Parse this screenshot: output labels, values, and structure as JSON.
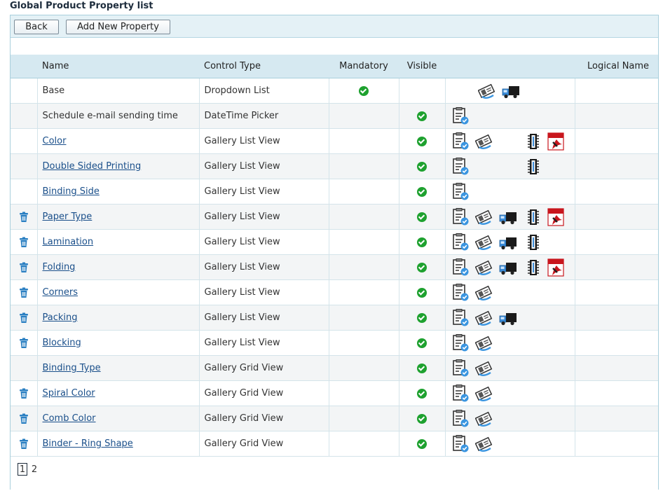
{
  "page": {
    "title": "Global Product Property list"
  },
  "toolbar": {
    "back_label": "Back",
    "add_label": "Add New Property"
  },
  "table": {
    "headers": {
      "name": "Name",
      "control_type": "Control Type",
      "mandatory": "Mandatory",
      "visible": "Visible",
      "actions": "",
      "logical_name": "Logical Name"
    },
    "rows": [
      {
        "name": "Base",
        "link": false,
        "deletable": false,
        "control": "Dropdown List",
        "mandatory": true,
        "visible": false,
        "icons": [
          "price-icon",
          "delivery-truck-icon"
        ]
      },
      {
        "name": "Schedule e-mail sending time",
        "link": false,
        "deletable": false,
        "control": "DateTime Picker",
        "mandatory": false,
        "visible": true,
        "icons": [
          "clipboard-check-icon"
        ]
      },
      {
        "name": "Color",
        "link": true,
        "deletable": false,
        "control": "Gallery List View",
        "mandatory": false,
        "visible": true,
        "icons": [
          "clipboard-check-icon",
          "price-icon",
          "chip-icon",
          "pdf-icon"
        ]
      },
      {
        "name": "Double Sided Printing",
        "link": true,
        "deletable": false,
        "control": "Gallery List View",
        "mandatory": false,
        "visible": true,
        "icons": [
          "clipboard-check-icon",
          "chip-icon"
        ]
      },
      {
        "name": "Binding Side",
        "link": true,
        "deletable": false,
        "control": "Gallery List View",
        "mandatory": false,
        "visible": true,
        "icons": [
          "clipboard-check-icon"
        ]
      },
      {
        "name": "Paper Type",
        "link": true,
        "deletable": true,
        "control": "Gallery List View",
        "mandatory": false,
        "visible": true,
        "icons": [
          "clipboard-check-icon",
          "price-icon",
          "delivery-truck-icon",
          "chip-icon",
          "pdf-icon"
        ]
      },
      {
        "name": "Lamination",
        "link": true,
        "deletable": true,
        "control": "Gallery List View",
        "mandatory": false,
        "visible": true,
        "icons": [
          "clipboard-check-icon",
          "price-icon",
          "delivery-truck-icon",
          "chip-icon"
        ]
      },
      {
        "name": "Folding",
        "link": true,
        "deletable": true,
        "control": "Gallery List View",
        "mandatory": false,
        "visible": true,
        "icons": [
          "clipboard-check-icon",
          "price-icon",
          "delivery-truck-icon",
          "chip-icon",
          "pdf-icon"
        ]
      },
      {
        "name": "Corners",
        "link": true,
        "deletable": true,
        "control": "Gallery List View",
        "mandatory": false,
        "visible": true,
        "icons": [
          "clipboard-check-icon",
          "price-icon"
        ]
      },
      {
        "name": "Packing",
        "link": true,
        "deletable": true,
        "control": "Gallery List View",
        "mandatory": false,
        "visible": true,
        "icons": [
          "clipboard-check-icon",
          "price-icon",
          "delivery-truck-icon"
        ]
      },
      {
        "name": "Blocking",
        "link": true,
        "deletable": true,
        "control": "Gallery List View",
        "mandatory": false,
        "visible": true,
        "icons": [
          "clipboard-check-icon",
          "price-icon"
        ]
      },
      {
        "name": "Binding Type",
        "link": true,
        "deletable": false,
        "control": "Gallery Grid View",
        "mandatory": false,
        "visible": true,
        "icons": [
          "clipboard-check-icon",
          "price-icon"
        ]
      },
      {
        "name": "Spiral Color",
        "link": true,
        "deletable": true,
        "control": "Gallery Grid View",
        "mandatory": false,
        "visible": true,
        "icons": [
          "clipboard-check-icon",
          "price-icon"
        ]
      },
      {
        "name": "Comb Color",
        "link": true,
        "deletable": true,
        "control": "Gallery Grid View",
        "mandatory": false,
        "visible": true,
        "icons": [
          "clipboard-check-icon",
          "price-icon"
        ]
      },
      {
        "name": "Binder - Ring Shape",
        "link": true,
        "deletable": true,
        "control": "Gallery Grid View",
        "mandatory": false,
        "visible": true,
        "icons": [
          "clipboard-check-icon",
          "price-icon"
        ]
      }
    ]
  },
  "pager": {
    "pages": [
      "1",
      "2"
    ],
    "current": "1"
  },
  "colors": {
    "accent": "#1a4f8a",
    "header_bg": "#d6e9f1",
    "check": "#1ea12f"
  }
}
